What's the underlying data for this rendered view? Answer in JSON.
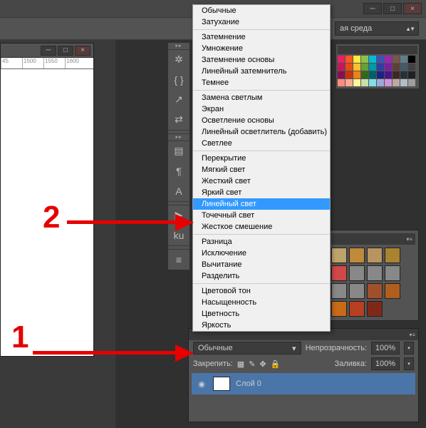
{
  "window": {
    "min": "─",
    "max": "□",
    "close": "×"
  },
  "workspace": {
    "label": "ая среда"
  },
  "ruler": {
    "ticks": [
      "45",
      "1500",
      "1550",
      "1600"
    ]
  },
  "icons": {
    "wheel": "✲",
    "brackets": "{ }",
    "brush": "↗",
    "swap": "⇄",
    "panel": "▤",
    "para": "¶",
    "type": "A",
    "play": "▶",
    "ku": "ku",
    "meter": "≡"
  },
  "menu": {
    "groups": [
      [
        "Обычные",
        "Затухание"
      ],
      [
        "Затемнение",
        "Умножение",
        "Затемнение основы",
        "Линейный затемнитель",
        "Темнее"
      ],
      [
        "Замена светлым",
        "Экран",
        "Осветление основы",
        "Линейный осветлитель (добавить)",
        "Светлее"
      ],
      [
        "Перекрытие",
        "Мягкий свет",
        "Жесткий свет",
        "Яркий свет",
        "Линейный свет",
        "Точечный свет",
        "Жесткое смешение"
      ],
      [
        "Разница",
        "Исключение",
        "Вычитание",
        "Разделить"
      ],
      [
        "Цветовой тон",
        "Насыщенность",
        "Цветность",
        "Яркость"
      ]
    ],
    "selected": "Линейный свет"
  },
  "swatches": {
    "rows": [
      [
        "#e91e63",
        "#ff5722",
        "#ffeb3b",
        "#8bc34a",
        "#00bcd4",
        "#3f51b5",
        "#9c27b0",
        "#795548",
        "#607d8b",
        "#000"
      ],
      [
        "#c2185b",
        "#e64a19",
        "#fbc02d",
        "#689f38",
        "#0097a7",
        "#303f9f",
        "#7b1fa2",
        "#5d4037",
        "#455a64",
        "#424242"
      ],
      [
        "#880e4f",
        "#bf360c",
        "#f57f17",
        "#33691e",
        "#006064",
        "#1a237e",
        "#4a148c",
        "#3e2723",
        "#263238",
        "#212121"
      ],
      [
        "#ff8a80",
        "#ffab91",
        "#fff59d",
        "#c5e1a5",
        "#80deea",
        "#9fa8da",
        "#ce93d8",
        "#bcaaa4",
        "#b0bec5",
        "#9e9e9e"
      ]
    ]
  },
  "panelA": {
    "row1": [
      "#bfa46a",
      "#c08a3a",
      "#b8945e",
      "#a88430",
      "#d04848"
    ],
    "row2": [
      "#888",
      "#888",
      "#888",
      "#888",
      "#888"
    ],
    "row3": [
      "#a0502a",
      "#b05e20",
      "#c86a18",
      "#b84020",
      "#802818"
    ]
  },
  "layers": {
    "mode_label": "Обычные",
    "opacity_label": "Непрозрачность:",
    "opacity_value": "100%",
    "lock_label": "Закрепить:",
    "fill_label": "Заливка:",
    "fill_value": "100%",
    "layer0": "Слой 0"
  },
  "ann": {
    "a": "1",
    "b": "2"
  }
}
